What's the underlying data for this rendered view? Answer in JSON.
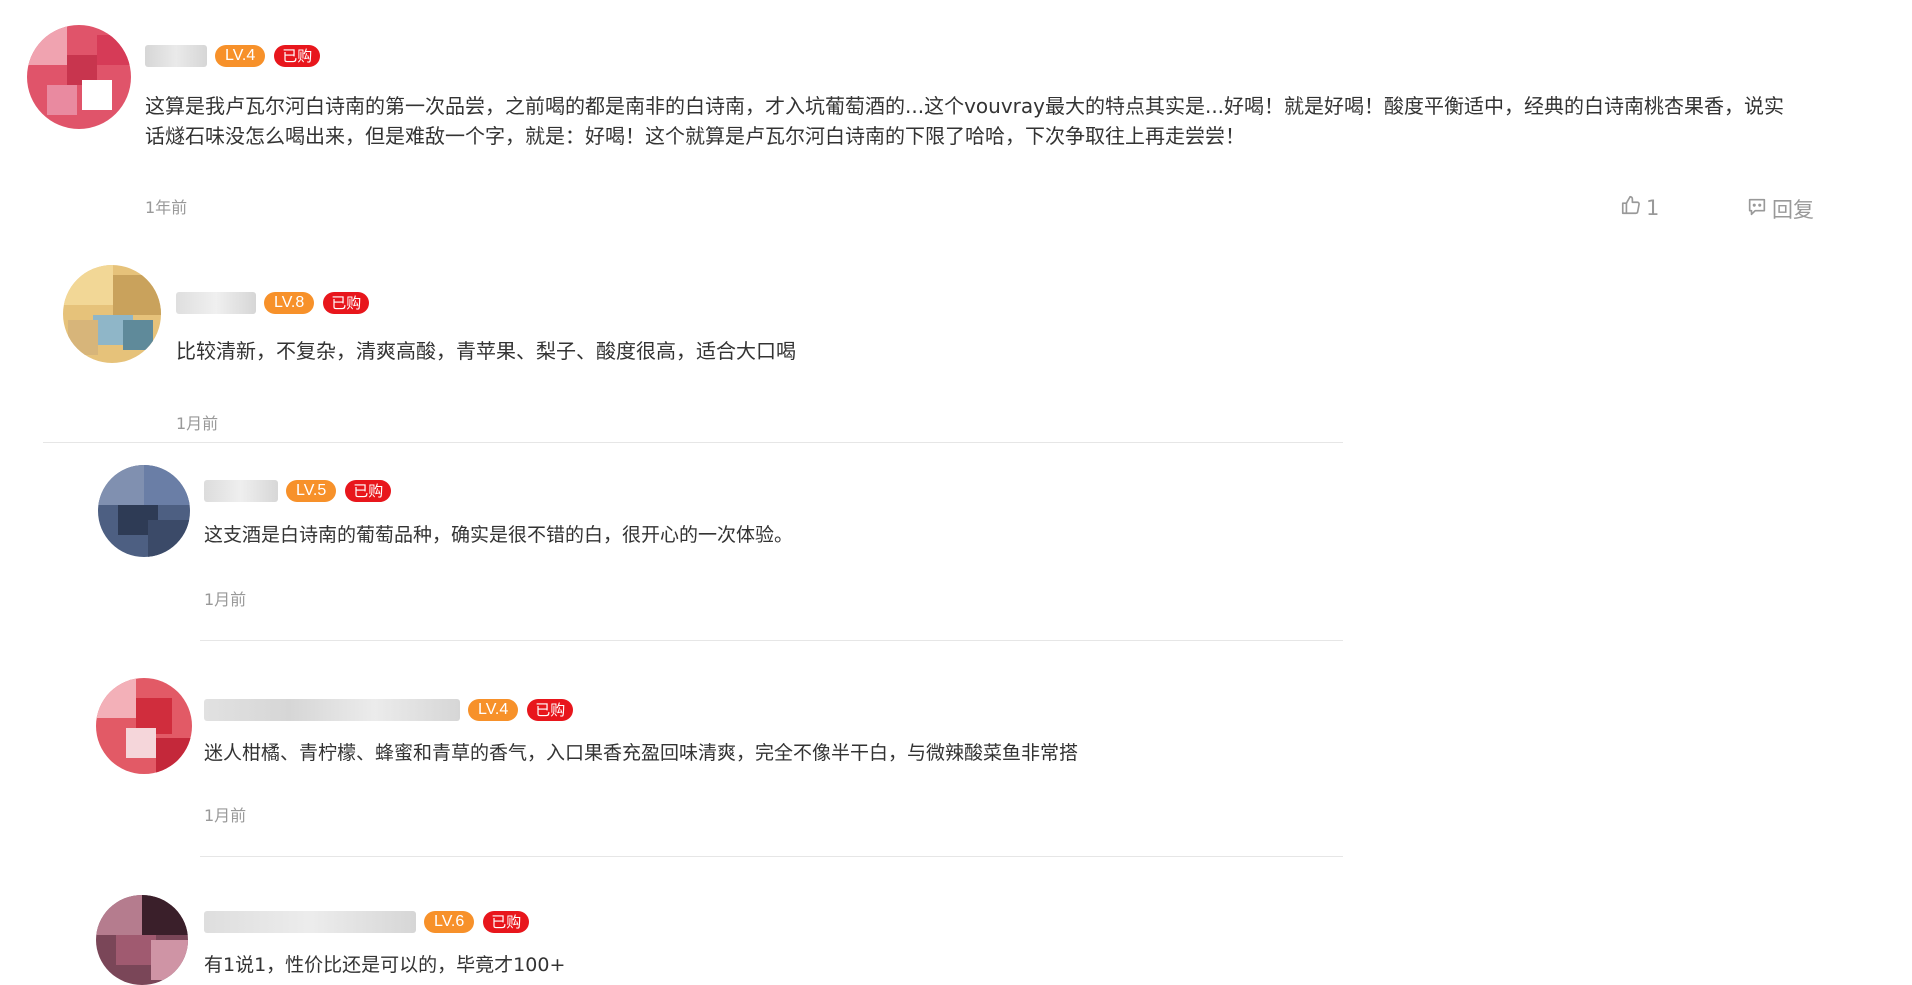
{
  "comments": [
    {
      "level": "LV.4",
      "purchased": "已购",
      "text": "这算是我卢瓦尔河白诗南的第一次品尝，之前喝的都是南非的白诗南，才入坑葡萄酒的...这个vouvray最大的特点其实是...好喝！就是好喝！酸度平衡适中，经典的白诗南桃杏果香，说实话燧石味没怎么喝出来，但是难敌一个字，就是：好喝！这个就算是卢瓦尔河白诗南的下限了哈哈，下次争取往上再走尝尝！",
      "time": "1年前",
      "likes": "1",
      "reply_label": "回复"
    },
    {
      "level": "LV.8",
      "purchased": "已购",
      "text": "比较清新，不复杂，清爽高酸，青苹果、梨子、酸度很高，适合大口喝",
      "time": "1月前"
    },
    {
      "level": "LV.5",
      "purchased": "已购",
      "text": "这支酒是白诗南的葡萄品种，确实是很不错的白，很开心的一次体验。",
      "time": "1月前"
    },
    {
      "level": "LV.4",
      "purchased": "已购",
      "text": "迷人柑橘、青柠檬、蜂蜜和青草的香气，入口果香充盈回味清爽，完全不像半干白，与微辣酸菜鱼非常搭",
      "time": "1月前"
    },
    {
      "level": "LV.6",
      "purchased": "已购",
      "text": "有1说1，性价比还是可以的，毕竟才100+"
    }
  ],
  "icons": {
    "like": "thumbs-up-icon",
    "reply": "comment-bubble-icon"
  },
  "colors": {
    "level_badge": "#f7912a",
    "purchased_badge": "#e8161c",
    "muted": "#999999"
  }
}
